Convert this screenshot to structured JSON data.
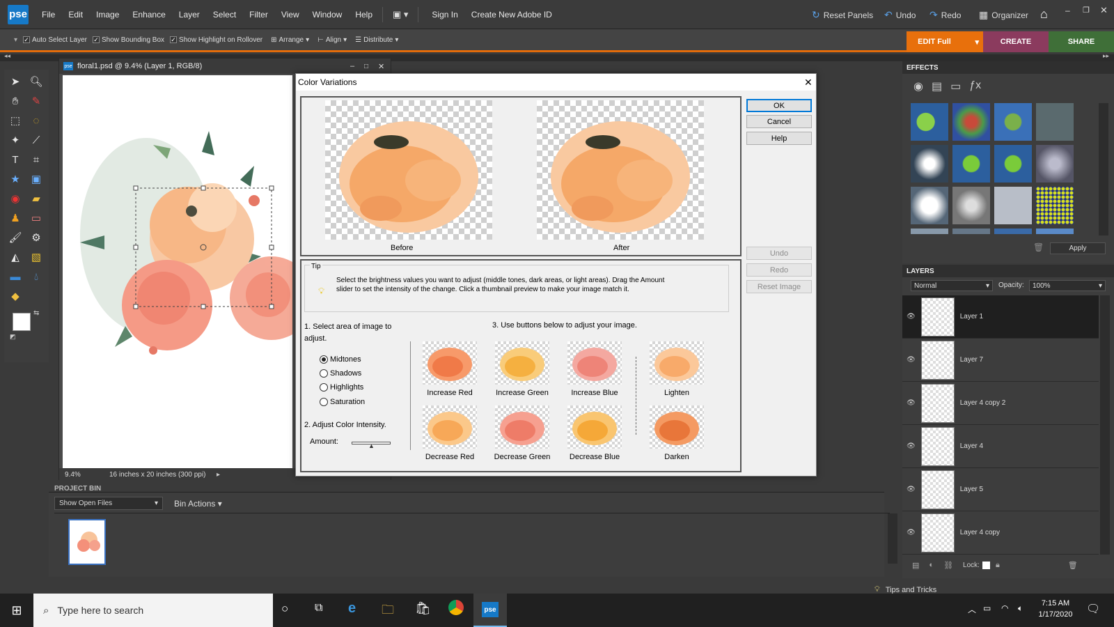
{
  "app": {
    "logo": "pse",
    "menus": [
      "File",
      "Edit",
      "Image",
      "Enhance",
      "Layer",
      "Select",
      "Filter",
      "View",
      "Window",
      "Help"
    ],
    "sign_in": "Sign In",
    "create_id": "Create New Adobe ID",
    "reset_panels": "Reset Panels",
    "undo": "Undo",
    "redo": "Redo",
    "organizer": "Organizer"
  },
  "options_bar": {
    "auto_select": "Auto Select Layer",
    "bounding_box": "Show Bounding Box",
    "highlight": "Show Highlight on Rollover",
    "arrange": "Arrange",
    "align": "Align",
    "distribute": "Distribute"
  },
  "mode_tabs": {
    "edit": "EDIT Full",
    "create": "CREATE",
    "share": "SHARE"
  },
  "document": {
    "title": "floral1.psd @ 9.4% (Layer 1, RGB/8)",
    "zoom": "9.4%",
    "size_info": "16 inches x 20 inches (300 ppi)"
  },
  "project_bin": {
    "title": "PROJECT BIN",
    "show": "Show Open Files",
    "actions": "Bin Actions"
  },
  "effects": {
    "title": "EFFECTS",
    "apply": "Apply"
  },
  "layers": {
    "title": "LAYERS",
    "blend_mode": "Normal",
    "opacity_label": "Opacity:",
    "opacity_value": "100%",
    "lock_label": "Lock:",
    "items": [
      "Layer 1",
      "Layer 7",
      "Layer 4 copy 2",
      "Layer 4",
      "Layer 5",
      "Layer 4 copy"
    ]
  },
  "dialog": {
    "title": "Color Variations",
    "ok": "OK",
    "cancel": "Cancel",
    "help": "Help",
    "undo": "Undo",
    "redo": "Redo",
    "reset": "Reset Image",
    "before": "Before",
    "after": "After",
    "tip_title": "Tip",
    "tip_text": "Select the brightness values you want to adjust (middle tones, dark areas, or light areas). Drag the Amount slider to set the intensity of the change. Click a thumbnail preview to make your image match it.",
    "step1": "1. Select area of image to adjust.",
    "step2": "2. Adjust Color Intensity.",
    "step3": "3. Use buttons below to adjust your image.",
    "amount": "Amount:",
    "radios": [
      "Midtones",
      "Shadows",
      "Highlights",
      "Saturation"
    ],
    "selected_radio": "Midtones",
    "variations": [
      "Increase Red",
      "Increase Green",
      "Increase Blue",
      "Lighten",
      "Decrease Red",
      "Decrease Green",
      "Decrease Blue",
      "Darken"
    ]
  },
  "status": {
    "tips": "Tips and Tricks"
  },
  "taskbar": {
    "search_placeholder": "Type here to search",
    "time": "7:15 AM",
    "date": "1/17/2020",
    "active_app": "pse"
  }
}
